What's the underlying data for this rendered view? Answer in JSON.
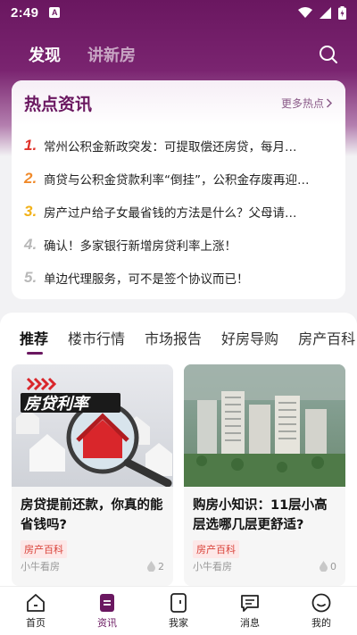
{
  "status": {
    "time": "2:49",
    "notif": "A"
  },
  "top_tabs": [
    {
      "label": "发现",
      "active": true
    },
    {
      "label": "讲新房",
      "active": false
    }
  ],
  "hot": {
    "title": "热点资讯",
    "more": "更多热点",
    "items": [
      {
        "num": "1.",
        "color": "#e0322a",
        "text": "常州公积金新政突发：可提取偿还房贷，每月…"
      },
      {
        "num": "2.",
        "color": "#f08a2a",
        "text": "商贷与公积金贷款利率“倒挂”，公积金存废再迎…"
      },
      {
        "num": "3.",
        "color": "#f2b21a",
        "text": "房产过户给子女最省钱的方法是什么？父母请…"
      },
      {
        "num": "4.",
        "color": "#b8b8b8",
        "text": "确认！多家银行新增房贷利率上涨！"
      },
      {
        "num": "5.",
        "color": "#b8b8b8",
        "text": "单边代理服务，可不是签个协议而已！"
      }
    ]
  },
  "categories": [
    "推荐",
    "楼市行情",
    "市场报告",
    "好房导购",
    "房产百科"
  ],
  "cards": [
    {
      "banner": "房贷利率",
      "title": "房贷提前还款，你真的能省钱吗?",
      "tag": "房产百科",
      "author": "小牛看房",
      "likes": "2"
    },
    {
      "title": "购房小知识：11层小高层选哪几层更舒适?",
      "tag": "房产百科",
      "author": "小牛看房",
      "likes": "0"
    }
  ],
  "nav": [
    {
      "label": "首页",
      "icon": "home-icon",
      "active": false
    },
    {
      "label": "资讯",
      "icon": "news-icon",
      "active": true
    },
    {
      "label": "我家",
      "icon": "my-home-icon",
      "active": false
    },
    {
      "label": "消息",
      "icon": "message-icon",
      "active": false
    },
    {
      "label": "我的",
      "icon": "profile-icon",
      "active": false
    }
  ],
  "colors": {
    "brand": "#6a1760",
    "tag_bg": "#fde8e8",
    "tag_text": "#d9433a"
  }
}
